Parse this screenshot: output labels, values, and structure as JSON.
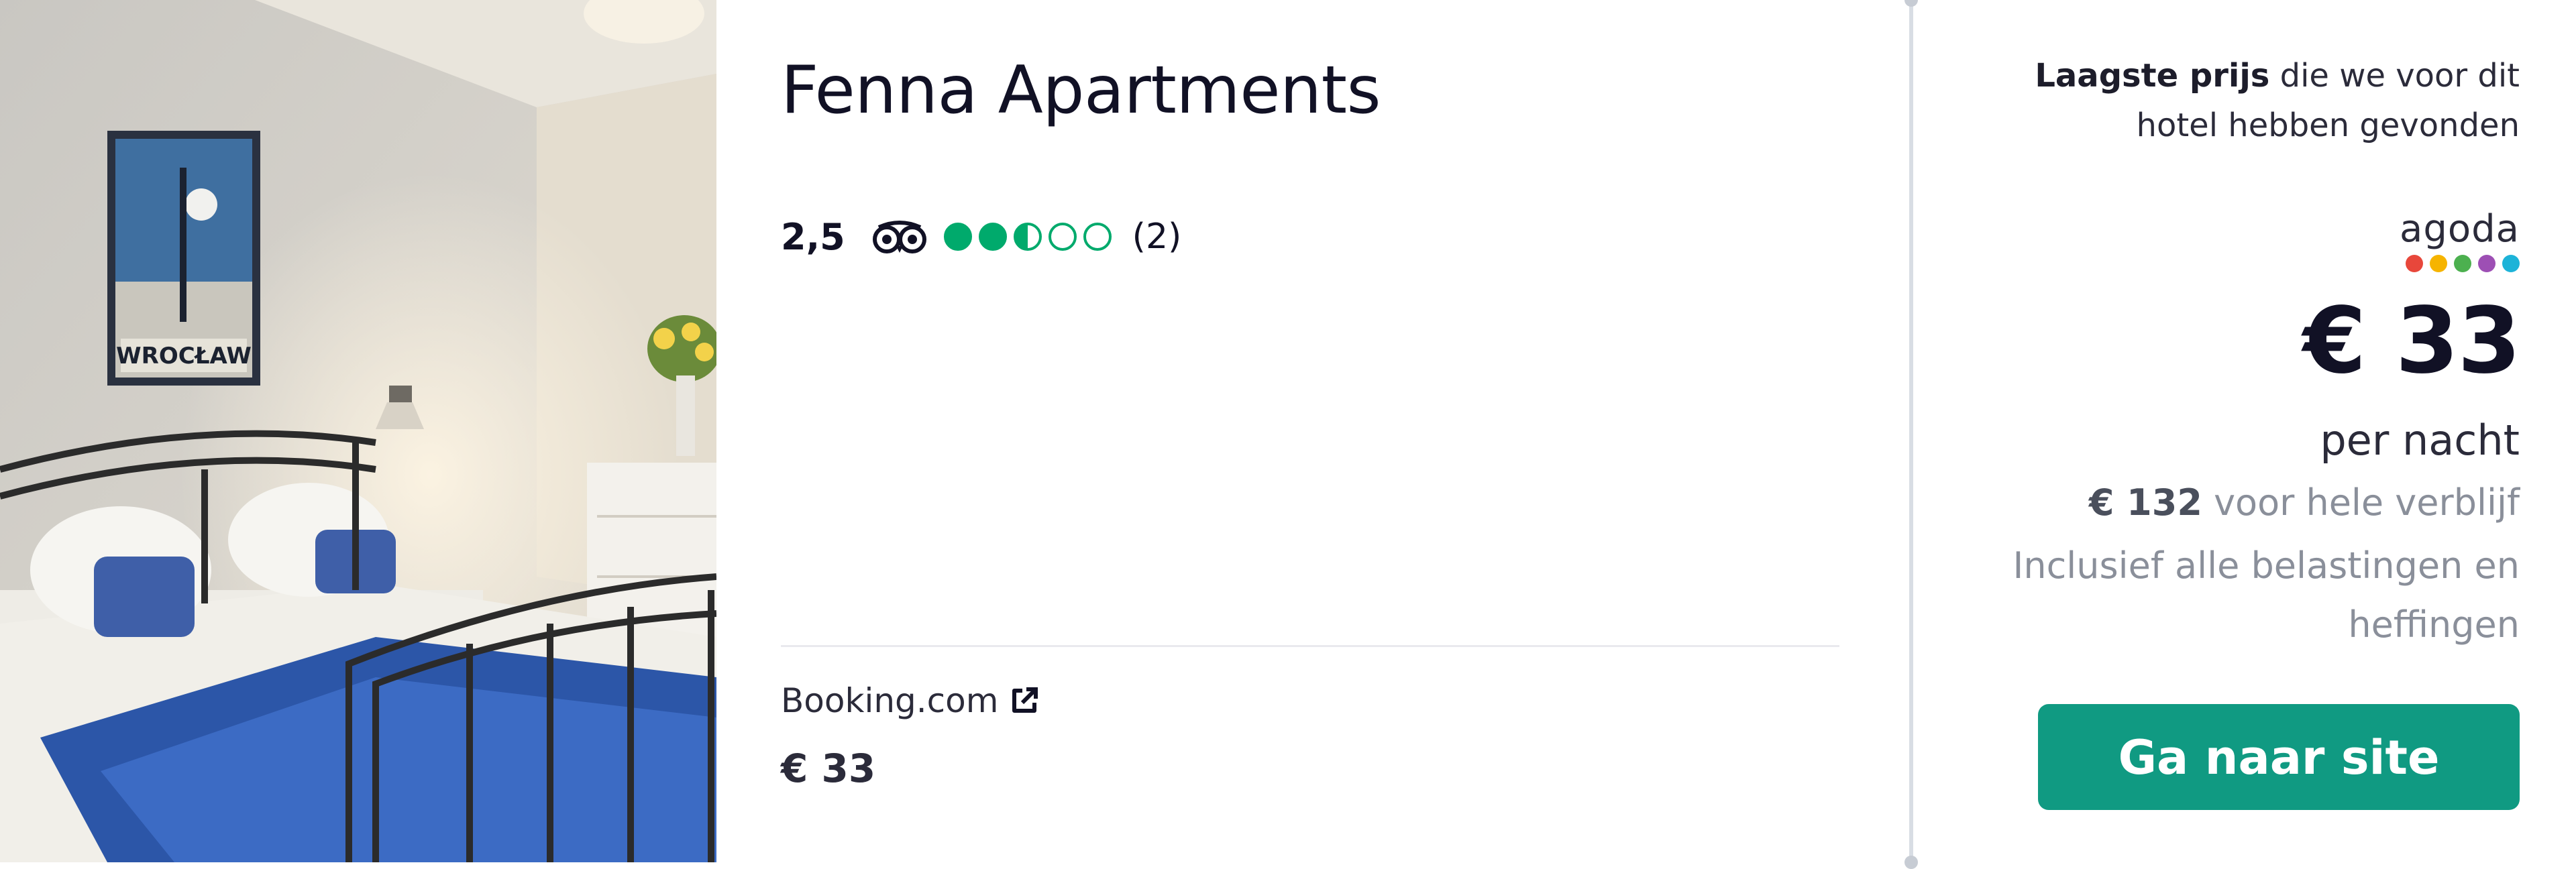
{
  "hotel": {
    "name": "Fenna Apartments",
    "rating_score": "2,5",
    "rating_value": 2.5,
    "rating_max": 5,
    "review_count": "(2)",
    "photo_poster_text": "WROCŁAW"
  },
  "provider": {
    "name": "Booking.com",
    "price": "€ 33"
  },
  "deal": {
    "lowest_bold": "Laagste prijs",
    "lowest_rest": " die we voor dit hotel hebben gevonden",
    "partner_logo_text": "agoda",
    "price": "€ 33",
    "per_night": "per nacht",
    "total_bold": "€ 132",
    "total_rest": " voor hele verblijf",
    "taxes_note": "Inclusief alle belastingen en heffingen",
    "cta_label": "Ga naar site"
  },
  "colors": {
    "accent_green": "#109a82",
    "tripadvisor_green": "#00aa6c",
    "agoda_dots": [
      "#e8473b",
      "#f6b400",
      "#4cb04f",
      "#9d4fb4",
      "#1db3d8"
    ]
  },
  "icons": {
    "tripadvisor": "tripadvisor-owl-icon",
    "external_link": "external-link-icon"
  }
}
